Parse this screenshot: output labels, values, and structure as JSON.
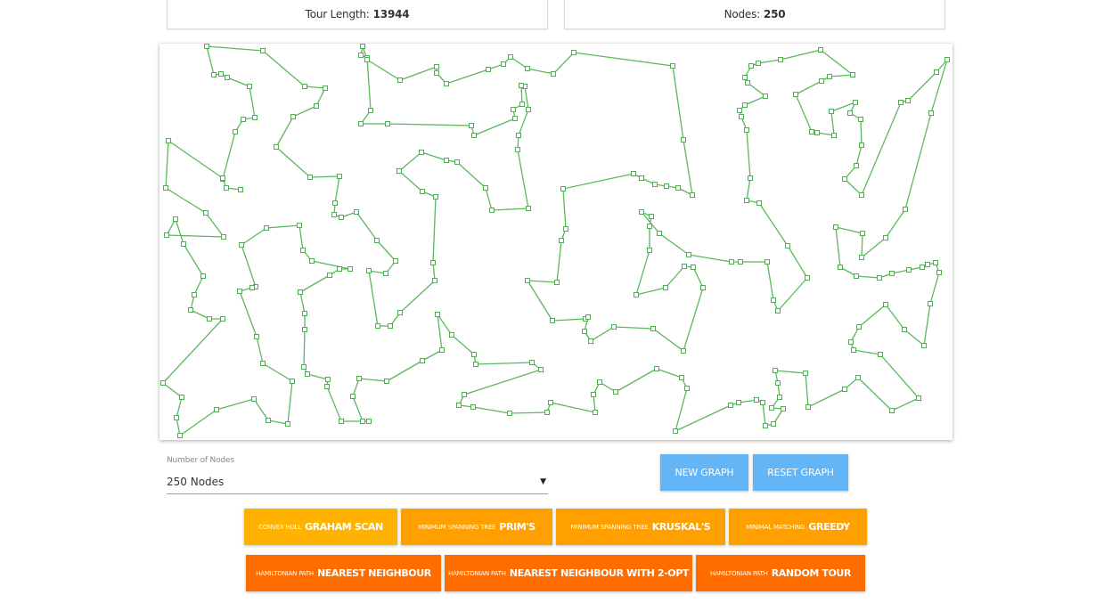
{
  "stats": {
    "tour_label": "Tour Length:",
    "tour_value": "13944",
    "nodes_label": "Nodes:",
    "nodes_value": "250"
  },
  "controls": {
    "select_label": "Number of Nodes",
    "select_value": "250 Nodes",
    "new_graph": "NEW GRAPH",
    "reset_graph": "RESET GRAPH"
  },
  "algorithms": [
    {
      "prefix": "Convex Hull",
      "name": "Graham Scan"
    },
    {
      "prefix": "Minimum Spanning Tree",
      "name": "Prim's"
    },
    {
      "prefix": "Minimum Spanning Tree",
      "name": "Kruskal's"
    },
    {
      "prefix": "Minimal Matching",
      "name": "Greedy"
    },
    {
      "prefix": "Hamiltonian Path",
      "name": "Nearest Neighbour"
    },
    {
      "prefix": "Hamiltonian Path",
      "name": "Nearest Neighbour with 2-opt"
    },
    {
      "prefix": "Hamiltonian Path",
      "name": "Random Tour"
    }
  ],
  "colors": {
    "edge": "#5cb85c",
    "node_stroke": "#4caf50",
    "blue_button": "#64b5f6",
    "amber_button": "#ffb300",
    "orange_button": "#ffa000",
    "deep_orange_button": "#ff6d00"
  }
}
